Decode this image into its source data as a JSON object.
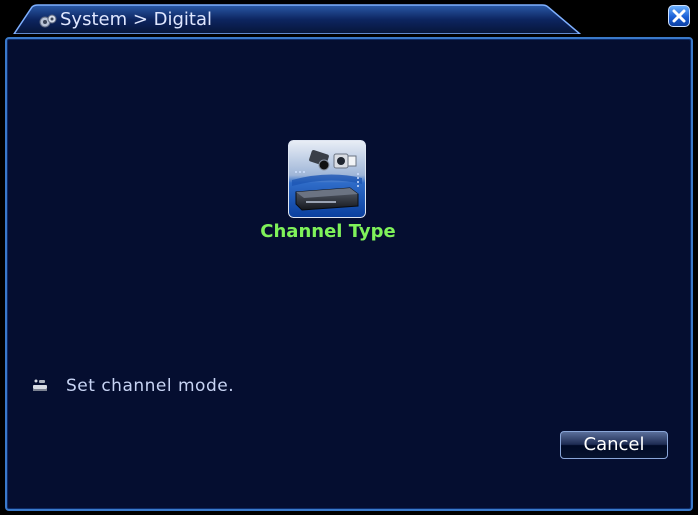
{
  "window": {
    "title": "System > Digital",
    "title_icon": "gear-icon",
    "close_icon": "close-icon"
  },
  "main": {
    "channel_type": {
      "label": "Channel Type",
      "icon": "camera-dvr-icon"
    },
    "hint": {
      "icon": "info-icon",
      "text": "Set channel mode."
    }
  },
  "footer": {
    "cancel_label": "Cancel"
  },
  "colors": {
    "background": "#050e30",
    "border": "#3a79c9",
    "label_green": "#7ff25a",
    "text": "#c8d4f4"
  }
}
